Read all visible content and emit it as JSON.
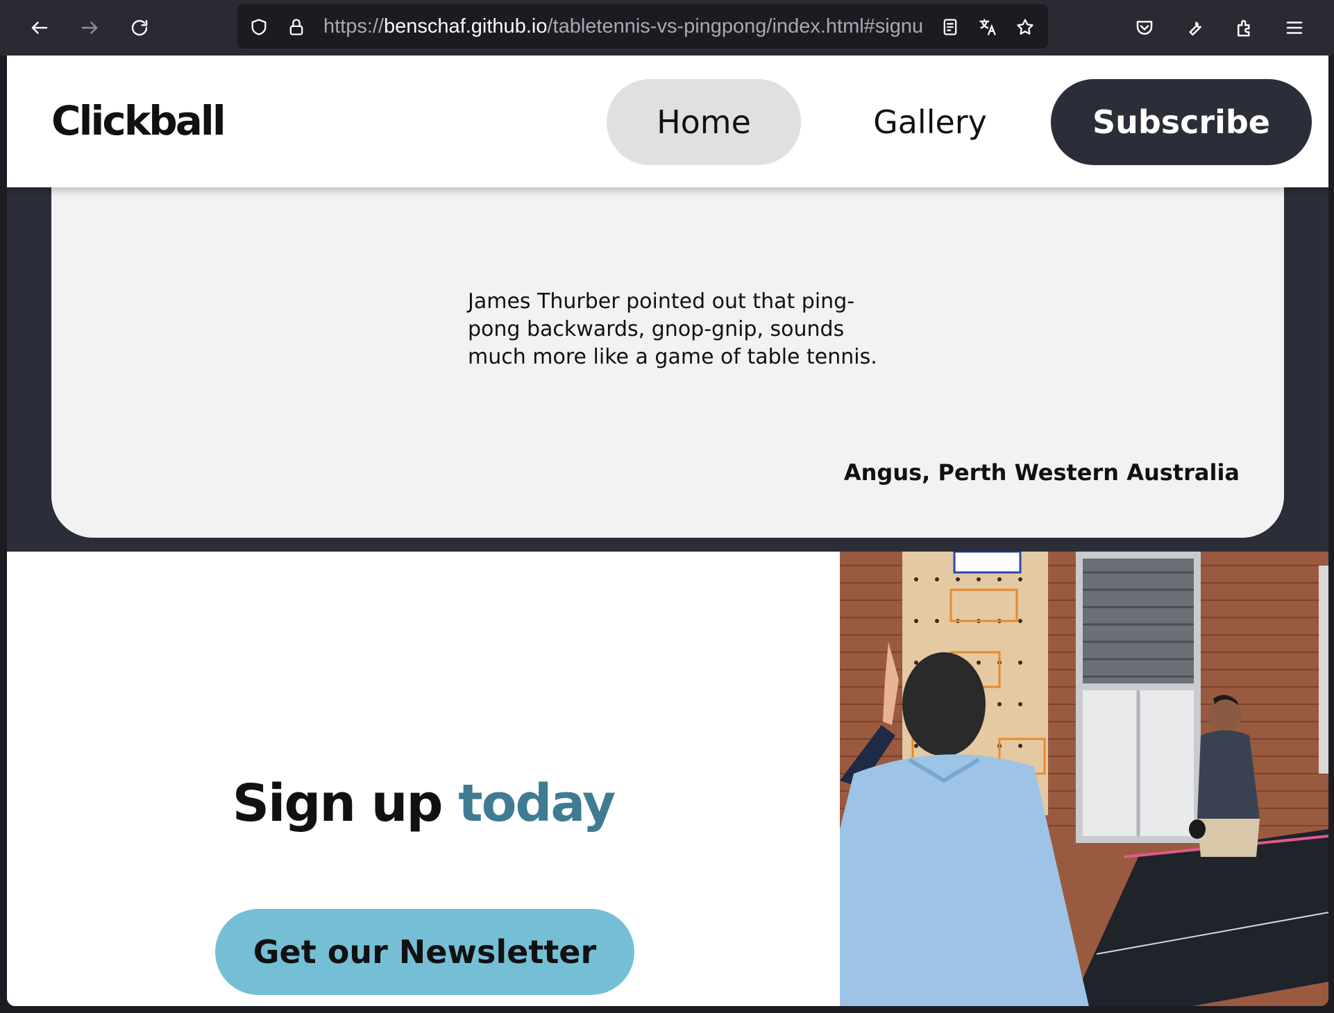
{
  "browser": {
    "url_scheme": "https://",
    "url_host": "benschaf.github.io",
    "url_path": "/tabletennis-vs-pingpong/index.html#signu",
    "icons": [
      "back-arrow-icon",
      "forward-arrow-icon",
      "reload-icon",
      "shield-icon",
      "lock-icon",
      "reader-view-icon",
      "translate-icon",
      "star-icon",
      "pocket-icon",
      "wrench-icon",
      "extensions-icon",
      "menu-icon"
    ]
  },
  "header": {
    "logo": "Clickball",
    "nav": {
      "home": "Home",
      "gallery": "Gallery",
      "subscribe": "Subscribe"
    }
  },
  "testimonial": {
    "quote": "James Thurber pointed out that ping-pong backwards, gnop-gnip, sounds much more like a game of table tennis.",
    "author": "Angus, Perth Western Australia"
  },
  "signup": {
    "title_main": "Sign up",
    "title_accent": "today",
    "button": "Get our Newsletter"
  },
  "colors": {
    "accent": "#3f7b92",
    "button": "#75bfd6",
    "dark": "#2b2d38"
  }
}
